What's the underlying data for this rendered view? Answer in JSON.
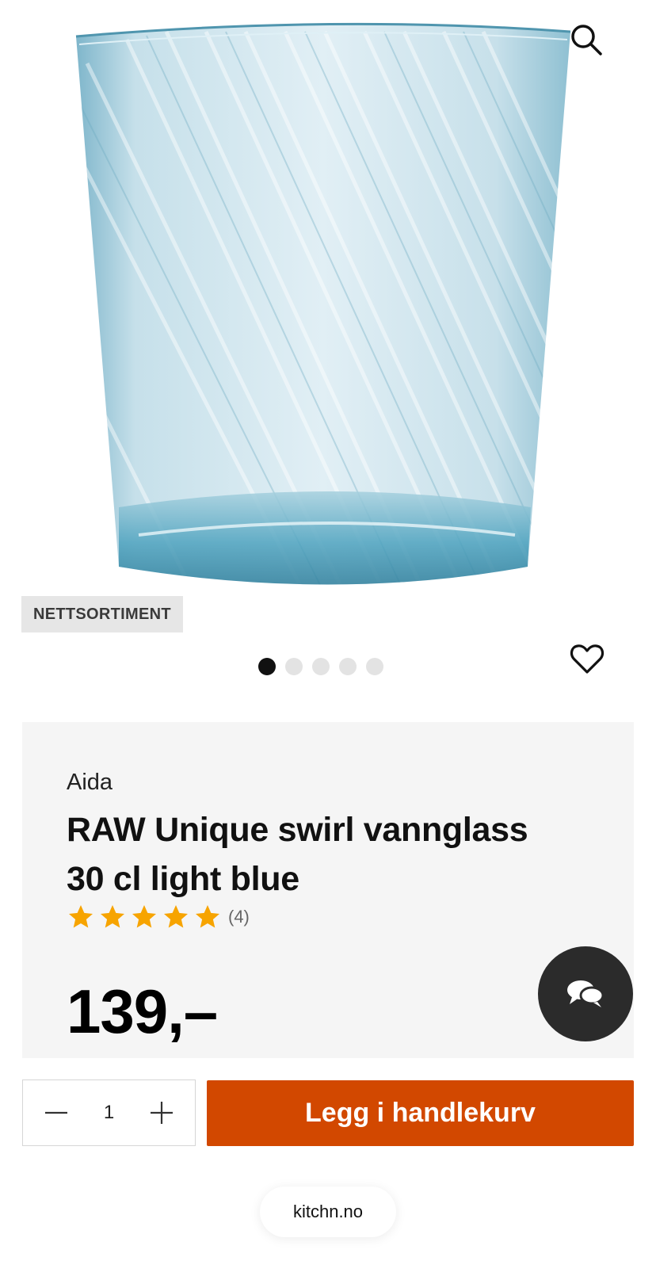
{
  "product": {
    "badge": "NETTSORTIMENT",
    "brand": "Aida",
    "title": "RAW Unique swirl vannglass 30 cl light blue",
    "rating": {
      "stars": 5,
      "max": 5,
      "count_label": "(4)"
    },
    "price": "139,–"
  },
  "gallery": {
    "total_images": 5,
    "active_index": 0
  },
  "cart": {
    "quantity": "1",
    "add_label": "Legg i handlekurv"
  },
  "footer": {
    "domain": "kitchn.no"
  },
  "icons": {
    "search": "search-icon",
    "favorite": "heart-icon",
    "chat": "chat-icon",
    "minus": "minus-icon",
    "plus": "plus-icon",
    "star": "star-icon"
  },
  "colors": {
    "accent": "#d24800",
    "star": "#f7a400",
    "chat_bg": "#2b2b2b",
    "info_bg": "#f5f5f5"
  }
}
